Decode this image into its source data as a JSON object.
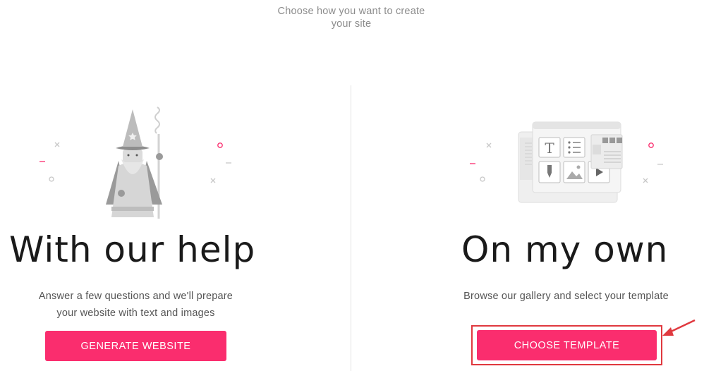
{
  "header": {
    "line1": "Choose how you want to create",
    "line2": "your site"
  },
  "left": {
    "title": "With our help",
    "desc_line1": "Answer a few questions and we'll prepare",
    "desc_line2": "your website with text and images",
    "button_label": "GENERATE WEBSITE"
  },
  "right": {
    "title": "On my own",
    "desc": "Browse our gallery and select your template",
    "button_label": "CHOOSE TEMPLATE"
  },
  "colors": {
    "accent": "#fa2d6e",
    "highlight": "#e0393f",
    "divider": "#e2e2e2"
  },
  "icons": [
    "wizard-illustration",
    "template-editor-illustration",
    "arrow-icon",
    "text-tool-icon",
    "list-tool-icon",
    "pen-tool-icon",
    "image-tool-icon",
    "video-tool-icon"
  ]
}
